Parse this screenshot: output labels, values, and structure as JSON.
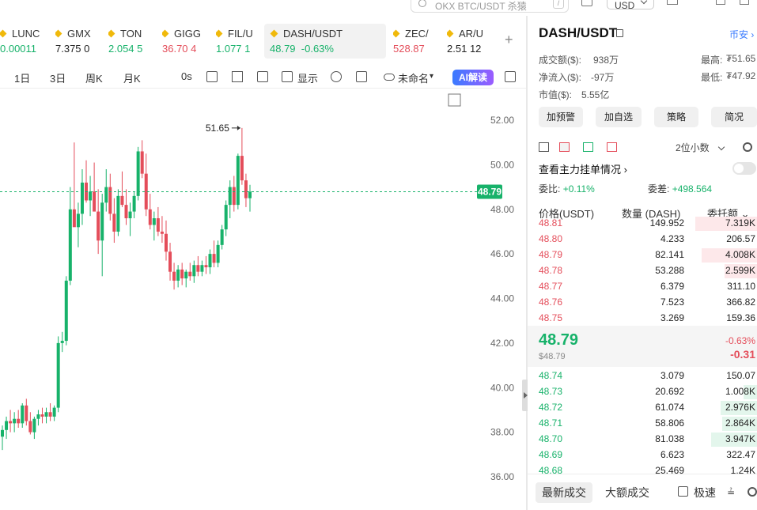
{
  "top": {
    "search_placeholder": "OKX BTC/USDT 杀猿",
    "search_hotkey": "/",
    "currency": "USD"
  },
  "tickers": [
    {
      "symbol": "LUNC",
      "price": "0.00011",
      "change": "",
      "color": "up"
    },
    {
      "symbol": "GMX",
      "price": "7.375",
      "change": "0",
      "color": "neutral"
    },
    {
      "symbol": "TON",
      "price": "2.054",
      "change": "5",
      "color": "up"
    },
    {
      "symbol": "GIGG",
      "price": "36.70",
      "change": "4",
      "color": "down"
    },
    {
      "symbol": "FIL/U",
      "price": "1.077",
      "change": "1",
      "color": "up"
    },
    {
      "symbol": "DASH/USDT",
      "price": "48.79",
      "change": "-0.63%",
      "color": "up"
    },
    {
      "symbol": "ZEC/",
      "price": "528.87",
      "change": "",
      "color": "down"
    },
    {
      "symbol": "AR/U",
      "price": "2.51",
      "change": "12",
      "color": "neutral"
    }
  ],
  "toolbar": {
    "day1": "1日",
    "day3": "3日",
    "week": "周K",
    "month": "月K",
    "timer": "0s",
    "display": "显示",
    "layout_name": "未命名",
    "ai_label": "AI解读"
  },
  "chart_data": {
    "type": "candlestick",
    "title": "",
    "xlabel": "",
    "ylabel": "",
    "ylim": [
      35,
      53
    ],
    "y_ticks": [
      "52.00",
      "50.00",
      "48.00",
      "46.00",
      "44.00",
      "42.00",
      "40.00",
      "38.00",
      "36.00"
    ],
    "current_price_label": "48.79",
    "current_price": 48.79,
    "high_marker": "51.65",
    "high_value": 51.65,
    "candles": [
      [
        37.8,
        38.3,
        37.2,
        38.1
      ],
      [
        38.1,
        38.7,
        37.7,
        38.5
      ],
      [
        38.5,
        39.0,
        38.0,
        38.4
      ],
      [
        38.4,
        38.9,
        38.0,
        38.6
      ],
      [
        38.6,
        39.0,
        38.2,
        38.4
      ],
      [
        38.4,
        39.3,
        38.2,
        39.2
      ],
      [
        39.2,
        39.5,
        38.3,
        38.5
      ],
      [
        38.5,
        38.9,
        37.9,
        38.0
      ],
      [
        38.0,
        38.7,
        37.7,
        38.6
      ],
      [
        38.6,
        39.0,
        38.3,
        38.8
      ],
      [
        38.8,
        39.1,
        38.4,
        38.7
      ],
      [
        38.7,
        39.1,
        38.4,
        38.9
      ],
      [
        38.9,
        39.3,
        38.5,
        38.7
      ],
      [
        38.7,
        39.2,
        38.5,
        39.1
      ],
      [
        39.1,
        42.3,
        38.9,
        42.0
      ],
      [
        42.0,
        42.5,
        41.6,
        42.1
      ],
      [
        42.1,
        45.0,
        41.9,
        44.8
      ],
      [
        44.8,
        49.0,
        44.6,
        48.0
      ],
      [
        48.0,
        51.0,
        47.6,
        47.2
      ],
      [
        47.2,
        48.3,
        46.3,
        47.8
      ],
      [
        47.8,
        49.8,
        47.3,
        49.2
      ],
      [
        49.2,
        50.2,
        48.3,
        48.4
      ],
      [
        48.4,
        49.5,
        47.7,
        48.8
      ],
      [
        48.8,
        50.1,
        48.3,
        47.9
      ],
      [
        47.9,
        48.9,
        46.0,
        46.6
      ],
      [
        46.6,
        48.7,
        45.0,
        48.3
      ],
      [
        48.3,
        49.8,
        47.9,
        49.0
      ],
      [
        49.0,
        49.6,
        47.5,
        47.8
      ],
      [
        47.8,
        48.5,
        46.5,
        47.0
      ],
      [
        47.0,
        48.9,
        46.8,
        48.6
      ],
      [
        48.6,
        49.7,
        48.1,
        48.2
      ],
      [
        48.2,
        48.9,
        47.3,
        47.6
      ],
      [
        47.6,
        48.3,
        46.8,
        47.9
      ],
      [
        47.9,
        48.8,
        47.6,
        48.6
      ],
      [
        48.6,
        50.8,
        48.4,
        50.6
      ],
      [
        50.6,
        51.1,
        49.4,
        49.6
      ],
      [
        49.6,
        50.5,
        47.7,
        48.0
      ],
      [
        48.0,
        48.7,
        47.1,
        47.3
      ],
      [
        47.3,
        47.9,
        46.6,
        47.6
      ],
      [
        47.6,
        48.1,
        46.8,
        47.0
      ],
      [
        47.0,
        47.7,
        46.5,
        46.9
      ],
      [
        46.9,
        47.5,
        45.7,
        46.1
      ],
      [
        46.1,
        46.5,
        44.8,
        45.2
      ],
      [
        45.2,
        45.6,
        44.4,
        44.8
      ],
      [
        44.8,
        45.5,
        44.5,
        45.3
      ],
      [
        45.3,
        45.6,
        44.6,
        44.9
      ],
      [
        44.9,
        45.3,
        44.5,
        45.2
      ],
      [
        45.2,
        45.6,
        44.8,
        45.0
      ],
      [
        45.0,
        45.7,
        44.7,
        45.5
      ],
      [
        45.5,
        45.9,
        45.0,
        45.2
      ],
      [
        45.2,
        45.7,
        45.0,
        45.5
      ],
      [
        45.5,
        45.9,
        45.1,
        45.4
      ],
      [
        45.4,
        46.2,
        45.1,
        46.0
      ],
      [
        46.0,
        46.6,
        45.4,
        45.6
      ],
      [
        45.6,
        46.6,
        45.4,
        46.4
      ],
      [
        46.4,
        47.3,
        46.2,
        47.1
      ],
      [
        47.1,
        48.4,
        46.8,
        48.2
      ],
      [
        48.2,
        49.3,
        47.6,
        49.0
      ],
      [
        49.0,
        49.5,
        47.9,
        48.2
      ],
      [
        48.2,
        50.5,
        48.0,
        50.4
      ],
      [
        50.4,
        51.65,
        49.1,
        49.3
      ],
      [
        49.3,
        49.6,
        48.1,
        48.5
      ],
      [
        48.5,
        49.1,
        47.9,
        48.79
      ]
    ]
  },
  "right_panel": {
    "pair": "DASH/USDT",
    "exchange": "币安",
    "volume_label": "成交额($):",
    "volume_value": "938万",
    "high_label": "最高:",
    "high_value": "₮51.65",
    "netflow_label": "净流入($):",
    "netflow_value": "-97万",
    "low_label": "最低:",
    "low_value": "₮47.92",
    "mcap_label": "市值($):",
    "mcap_value": "5.55亿",
    "btn_alert": "加预警",
    "btn_watch": "加自选",
    "btn_strategy": "策略",
    "btn_brief": "简况",
    "decimals": "2位小数",
    "main_force": "查看主力挂单情况",
    "ratio_label": "委比:",
    "ratio_value": "+0.11%",
    "diff_label": "委差:",
    "diff_value": "+498.564",
    "col_price": "价格(USDT)",
    "col_qty": "数量 (DASH)",
    "col_total": "委托额",
    "asks": [
      {
        "price": "48.81",
        "qty": "149.952",
        "total": "7.319K",
        "depth": 0.27
      },
      {
        "price": "48.80",
        "qty": "4.233",
        "total": "206.57",
        "depth": 0
      },
      {
        "price": "48.79",
        "qty": "82.141",
        "total": "4.008K",
        "depth": 0.24
      },
      {
        "price": "48.78",
        "qty": "53.288",
        "total": "2.599K",
        "depth": 0.14
      },
      {
        "price": "48.77",
        "qty": "6.379",
        "total": "311.10",
        "depth": 0
      },
      {
        "price": "48.76",
        "qty": "7.523",
        "total": "366.82",
        "depth": 0
      },
      {
        "price": "48.75",
        "qty": "3.269",
        "total": "159.36",
        "depth": 0
      }
    ],
    "last_price": "48.79",
    "last_price_usd": "$48.79",
    "last_pct": "-0.63%",
    "last_change": "-0.31",
    "bids": [
      {
        "price": "48.74",
        "qty": "3.079",
        "total": "150.07",
        "depth": 0
      },
      {
        "price": "48.73",
        "qty": "20.692",
        "total": "1.008K",
        "depth": 0.06
      },
      {
        "price": "48.72",
        "qty": "61.074",
        "total": "2.976K",
        "depth": 0.16
      },
      {
        "price": "48.71",
        "qty": "58.806",
        "total": "2.864K",
        "depth": 0.15
      },
      {
        "price": "48.70",
        "qty": "81.038",
        "total": "3.947K",
        "depth": 0.2
      },
      {
        "price": "48.69",
        "qty": "6.623",
        "total": "322.47",
        "depth": 0
      },
      {
        "price": "48.68",
        "qty": "25.469",
        "total": "1.24K",
        "depth": 0
      }
    ],
    "tab_latest": "最新成交",
    "tab_large": "大额成交",
    "fast_label": "极速"
  },
  "colors": {
    "up": "#17b26a",
    "down": "#e44d5a",
    "accent": "#3a7bff",
    "price_tag": "#17b26a"
  }
}
